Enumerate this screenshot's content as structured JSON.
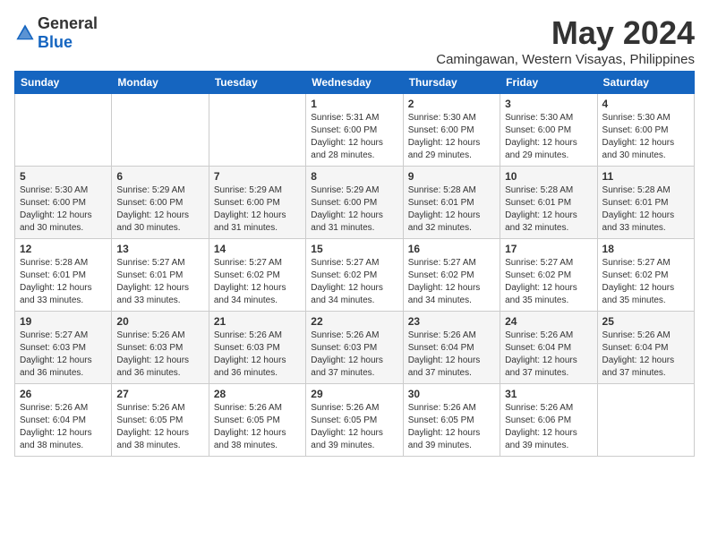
{
  "logo": {
    "general": "General",
    "blue": "Blue"
  },
  "title": "May 2024",
  "location": "Camingawan, Western Visayas, Philippines",
  "days_of_week": [
    "Sunday",
    "Monday",
    "Tuesday",
    "Wednesday",
    "Thursday",
    "Friday",
    "Saturday"
  ],
  "weeks": [
    [
      {
        "day": "",
        "sunrise": "",
        "sunset": "",
        "daylight": ""
      },
      {
        "day": "",
        "sunrise": "",
        "sunset": "",
        "daylight": ""
      },
      {
        "day": "",
        "sunrise": "",
        "sunset": "",
        "daylight": ""
      },
      {
        "day": "1",
        "sunrise": "Sunrise: 5:31 AM",
        "sunset": "Sunset: 6:00 PM",
        "daylight": "Daylight: 12 hours and 28 minutes."
      },
      {
        "day": "2",
        "sunrise": "Sunrise: 5:30 AM",
        "sunset": "Sunset: 6:00 PM",
        "daylight": "Daylight: 12 hours and 29 minutes."
      },
      {
        "day": "3",
        "sunrise": "Sunrise: 5:30 AM",
        "sunset": "Sunset: 6:00 PM",
        "daylight": "Daylight: 12 hours and 29 minutes."
      },
      {
        "day": "4",
        "sunrise": "Sunrise: 5:30 AM",
        "sunset": "Sunset: 6:00 PM",
        "daylight": "Daylight: 12 hours and 30 minutes."
      }
    ],
    [
      {
        "day": "5",
        "sunrise": "Sunrise: 5:30 AM",
        "sunset": "Sunset: 6:00 PM",
        "daylight": "Daylight: 12 hours and 30 minutes."
      },
      {
        "day": "6",
        "sunrise": "Sunrise: 5:29 AM",
        "sunset": "Sunset: 6:00 PM",
        "daylight": "Daylight: 12 hours and 30 minutes."
      },
      {
        "day": "7",
        "sunrise": "Sunrise: 5:29 AM",
        "sunset": "Sunset: 6:00 PM",
        "daylight": "Daylight: 12 hours and 31 minutes."
      },
      {
        "day": "8",
        "sunrise": "Sunrise: 5:29 AM",
        "sunset": "Sunset: 6:00 PM",
        "daylight": "Daylight: 12 hours and 31 minutes."
      },
      {
        "day": "9",
        "sunrise": "Sunrise: 5:28 AM",
        "sunset": "Sunset: 6:01 PM",
        "daylight": "Daylight: 12 hours and 32 minutes."
      },
      {
        "day": "10",
        "sunrise": "Sunrise: 5:28 AM",
        "sunset": "Sunset: 6:01 PM",
        "daylight": "Daylight: 12 hours and 32 minutes."
      },
      {
        "day": "11",
        "sunrise": "Sunrise: 5:28 AM",
        "sunset": "Sunset: 6:01 PM",
        "daylight": "Daylight: 12 hours and 33 minutes."
      }
    ],
    [
      {
        "day": "12",
        "sunrise": "Sunrise: 5:28 AM",
        "sunset": "Sunset: 6:01 PM",
        "daylight": "Daylight: 12 hours and 33 minutes."
      },
      {
        "day": "13",
        "sunrise": "Sunrise: 5:27 AM",
        "sunset": "Sunset: 6:01 PM",
        "daylight": "Daylight: 12 hours and 33 minutes."
      },
      {
        "day": "14",
        "sunrise": "Sunrise: 5:27 AM",
        "sunset": "Sunset: 6:02 PM",
        "daylight": "Daylight: 12 hours and 34 minutes."
      },
      {
        "day": "15",
        "sunrise": "Sunrise: 5:27 AM",
        "sunset": "Sunset: 6:02 PM",
        "daylight": "Daylight: 12 hours and 34 minutes."
      },
      {
        "day": "16",
        "sunrise": "Sunrise: 5:27 AM",
        "sunset": "Sunset: 6:02 PM",
        "daylight": "Daylight: 12 hours and 34 minutes."
      },
      {
        "day": "17",
        "sunrise": "Sunrise: 5:27 AM",
        "sunset": "Sunset: 6:02 PM",
        "daylight": "Daylight: 12 hours and 35 minutes."
      },
      {
        "day": "18",
        "sunrise": "Sunrise: 5:27 AM",
        "sunset": "Sunset: 6:02 PM",
        "daylight": "Daylight: 12 hours and 35 minutes."
      }
    ],
    [
      {
        "day": "19",
        "sunrise": "Sunrise: 5:27 AM",
        "sunset": "Sunset: 6:03 PM",
        "daylight": "Daylight: 12 hours and 36 minutes."
      },
      {
        "day": "20",
        "sunrise": "Sunrise: 5:26 AM",
        "sunset": "Sunset: 6:03 PM",
        "daylight": "Daylight: 12 hours and 36 minutes."
      },
      {
        "day": "21",
        "sunrise": "Sunrise: 5:26 AM",
        "sunset": "Sunset: 6:03 PM",
        "daylight": "Daylight: 12 hours and 36 minutes."
      },
      {
        "day": "22",
        "sunrise": "Sunrise: 5:26 AM",
        "sunset": "Sunset: 6:03 PM",
        "daylight": "Daylight: 12 hours and 37 minutes."
      },
      {
        "day": "23",
        "sunrise": "Sunrise: 5:26 AM",
        "sunset": "Sunset: 6:04 PM",
        "daylight": "Daylight: 12 hours and 37 minutes."
      },
      {
        "day": "24",
        "sunrise": "Sunrise: 5:26 AM",
        "sunset": "Sunset: 6:04 PM",
        "daylight": "Daylight: 12 hours and 37 minutes."
      },
      {
        "day": "25",
        "sunrise": "Sunrise: 5:26 AM",
        "sunset": "Sunset: 6:04 PM",
        "daylight": "Daylight: 12 hours and 37 minutes."
      }
    ],
    [
      {
        "day": "26",
        "sunrise": "Sunrise: 5:26 AM",
        "sunset": "Sunset: 6:04 PM",
        "daylight": "Daylight: 12 hours and 38 minutes."
      },
      {
        "day": "27",
        "sunrise": "Sunrise: 5:26 AM",
        "sunset": "Sunset: 6:05 PM",
        "daylight": "Daylight: 12 hours and 38 minutes."
      },
      {
        "day": "28",
        "sunrise": "Sunrise: 5:26 AM",
        "sunset": "Sunset: 6:05 PM",
        "daylight": "Daylight: 12 hours and 38 minutes."
      },
      {
        "day": "29",
        "sunrise": "Sunrise: 5:26 AM",
        "sunset": "Sunset: 6:05 PM",
        "daylight": "Daylight: 12 hours and 39 minutes."
      },
      {
        "day": "30",
        "sunrise": "Sunrise: 5:26 AM",
        "sunset": "Sunset: 6:05 PM",
        "daylight": "Daylight: 12 hours and 39 minutes."
      },
      {
        "day": "31",
        "sunrise": "Sunrise: 5:26 AM",
        "sunset": "Sunset: 6:06 PM",
        "daylight": "Daylight: 12 hours and 39 minutes."
      },
      {
        "day": "",
        "sunrise": "",
        "sunset": "",
        "daylight": ""
      }
    ]
  ]
}
